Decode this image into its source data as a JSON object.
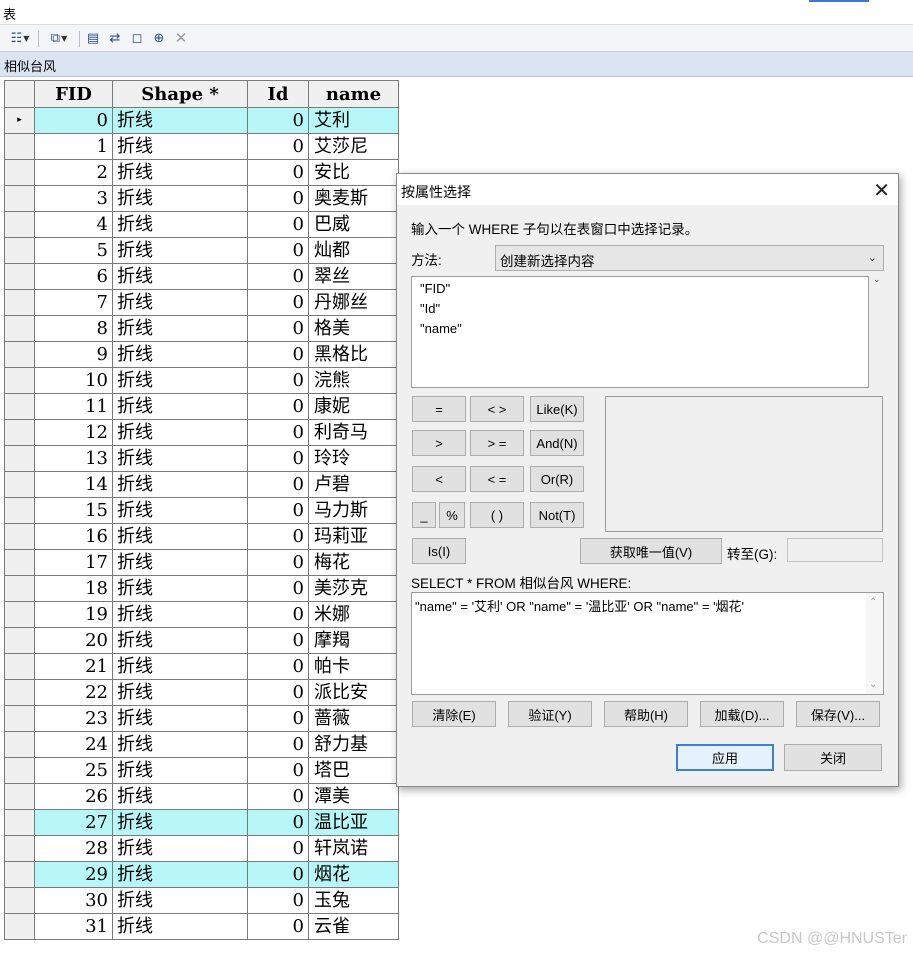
{
  "window": {
    "title": "表"
  },
  "tab": {
    "label": "相似台风"
  },
  "toolbar": {
    "icons": [
      "table-options-icon",
      "related-tables-icon",
      "select-by-attributes-icon",
      "switch-selection-icon",
      "clear-selection-icon",
      "zoom-to-selected-icon",
      "delete-selected-icon"
    ]
  },
  "table": {
    "headers": {
      "fid": "FID",
      "shape": "Shape *",
      "id": "Id",
      "name": "name"
    },
    "current_row_marker": "▸",
    "rows": [
      {
        "fid": "0",
        "shape": "折线",
        "id": "0",
        "name": "艾利",
        "hl": true
      },
      {
        "fid": "1",
        "shape": "折线",
        "id": "0",
        "name": "艾莎尼"
      },
      {
        "fid": "2",
        "shape": "折线",
        "id": "0",
        "name": "安比"
      },
      {
        "fid": "3",
        "shape": "折线",
        "id": "0",
        "name": "奥麦斯"
      },
      {
        "fid": "4",
        "shape": "折线",
        "id": "0",
        "name": "巴威"
      },
      {
        "fid": "5",
        "shape": "折线",
        "id": "0",
        "name": "灿都"
      },
      {
        "fid": "6",
        "shape": "折线",
        "id": "0",
        "name": "翠丝"
      },
      {
        "fid": "7",
        "shape": "折线",
        "id": "0",
        "name": "丹娜丝"
      },
      {
        "fid": "8",
        "shape": "折线",
        "id": "0",
        "name": "格美"
      },
      {
        "fid": "9",
        "shape": "折线",
        "id": "0",
        "name": "黑格比"
      },
      {
        "fid": "10",
        "shape": "折线",
        "id": "0",
        "name": "浣熊"
      },
      {
        "fid": "11",
        "shape": "折线",
        "id": "0",
        "name": "康妮"
      },
      {
        "fid": "12",
        "shape": "折线",
        "id": "0",
        "name": "利奇马"
      },
      {
        "fid": "13",
        "shape": "折线",
        "id": "0",
        "name": "玲玲"
      },
      {
        "fid": "14",
        "shape": "折线",
        "id": "0",
        "name": "卢碧"
      },
      {
        "fid": "15",
        "shape": "折线",
        "id": "0",
        "name": "马力斯"
      },
      {
        "fid": "16",
        "shape": "折线",
        "id": "0",
        "name": "玛莉亚"
      },
      {
        "fid": "17",
        "shape": "折线",
        "id": "0",
        "name": "梅花"
      },
      {
        "fid": "18",
        "shape": "折线",
        "id": "0",
        "name": "美莎克"
      },
      {
        "fid": "19",
        "shape": "折线",
        "id": "0",
        "name": "米娜"
      },
      {
        "fid": "20",
        "shape": "折线",
        "id": "0",
        "name": "摩羯"
      },
      {
        "fid": "21",
        "shape": "折线",
        "id": "0",
        "name": "帕卡"
      },
      {
        "fid": "22",
        "shape": "折线",
        "id": "0",
        "name": "派比安"
      },
      {
        "fid": "23",
        "shape": "折线",
        "id": "0",
        "name": "蔷薇"
      },
      {
        "fid": "24",
        "shape": "折线",
        "id": "0",
        "name": "舒力基"
      },
      {
        "fid": "25",
        "shape": "折线",
        "id": "0",
        "name": "塔巴"
      },
      {
        "fid": "26",
        "shape": "折线",
        "id": "0",
        "name": "潭美"
      },
      {
        "fid": "27",
        "shape": "折线",
        "id": "0",
        "name": "温比亚",
        "hl": true
      },
      {
        "fid": "28",
        "shape": "折线",
        "id": "0",
        "name": "轩岚诺"
      },
      {
        "fid": "29",
        "shape": "折线",
        "id": "0",
        "name": "烟花",
        "hl": true
      },
      {
        "fid": "30",
        "shape": "折线",
        "id": "0",
        "name": "玉兔"
      },
      {
        "fid": "31",
        "shape": "折线",
        "id": "0",
        "name": "云雀"
      }
    ]
  },
  "dialog": {
    "title": "按属性选择",
    "close_glyph": "✕",
    "prompt": "输入一个 WHERE 子句以在表窗口中选择记录。",
    "method_label": "方法:",
    "method_value": "创建新选择内容",
    "fields": [
      "\"FID\"",
      "\"Id\"",
      "\"name\""
    ],
    "operators": {
      "eq": "=",
      "neq": "< >",
      "like": "Like(K)",
      "gt": ">",
      "gte": "> =",
      "and": "And(N)",
      "lt": "<",
      "lte": "< =",
      "or": "Or(R)",
      "underscore": "_",
      "percent": "%",
      "parens": "( )",
      "not": "Not(T)",
      "is": "Is(I)"
    },
    "get_unique_label": "获取唯一值(V)",
    "goto_label": "转至(G):",
    "sql_prefix": "SELECT * FROM 相似台风 WHERE:",
    "sql_expression": "\"name\" = '艾利' OR \"name\" = '温比亚' OR \"name\" = '烟花'",
    "buttons": {
      "clear": "清除(E)",
      "verify": "验证(Y)",
      "help": "帮助(H)",
      "load": "加载(D)...",
      "save": "保存(V)...",
      "apply": "应用",
      "close": "关闭"
    }
  },
  "watermark": "CSDN @@HNUSTer",
  "colors": {
    "highlight": "#b7f7f7",
    "accent": "#3b7fd6"
  }
}
